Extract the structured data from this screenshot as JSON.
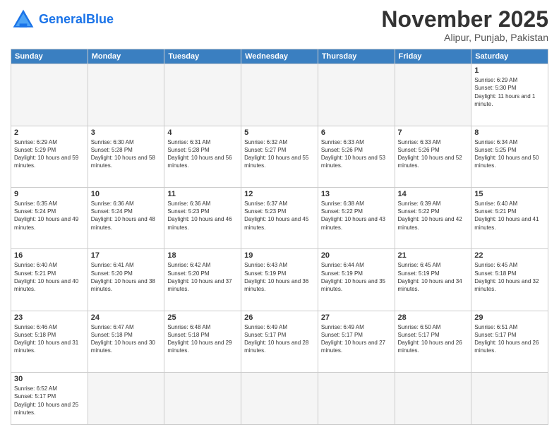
{
  "header": {
    "logo_general": "General",
    "logo_blue": "Blue",
    "title": "November 2025",
    "subtitle": "Alipur, Punjab, Pakistan"
  },
  "weekdays": [
    "Sunday",
    "Monday",
    "Tuesday",
    "Wednesday",
    "Thursday",
    "Friday",
    "Saturday"
  ],
  "weeks": [
    [
      {
        "day": "",
        "empty": true
      },
      {
        "day": "",
        "empty": true
      },
      {
        "day": "",
        "empty": true
      },
      {
        "day": "",
        "empty": true
      },
      {
        "day": "",
        "empty": true
      },
      {
        "day": "",
        "empty": true
      },
      {
        "day": "1",
        "sunrise": "Sunrise: 6:29 AM",
        "sunset": "Sunset: 5:30 PM",
        "daylight": "Daylight: 11 hours and 1 minute."
      }
    ],
    [
      {
        "day": "2",
        "sunrise": "Sunrise: 6:29 AM",
        "sunset": "Sunset: 5:29 PM",
        "daylight": "Daylight: 10 hours and 59 minutes."
      },
      {
        "day": "3",
        "sunrise": "Sunrise: 6:30 AM",
        "sunset": "Sunset: 5:28 PM",
        "daylight": "Daylight: 10 hours and 58 minutes."
      },
      {
        "day": "4",
        "sunrise": "Sunrise: 6:31 AM",
        "sunset": "Sunset: 5:28 PM",
        "daylight": "Daylight: 10 hours and 56 minutes."
      },
      {
        "day": "5",
        "sunrise": "Sunrise: 6:32 AM",
        "sunset": "Sunset: 5:27 PM",
        "daylight": "Daylight: 10 hours and 55 minutes."
      },
      {
        "day": "6",
        "sunrise": "Sunrise: 6:33 AM",
        "sunset": "Sunset: 5:26 PM",
        "daylight": "Daylight: 10 hours and 53 minutes."
      },
      {
        "day": "7",
        "sunrise": "Sunrise: 6:33 AM",
        "sunset": "Sunset: 5:26 PM",
        "daylight": "Daylight: 10 hours and 52 minutes."
      },
      {
        "day": "8",
        "sunrise": "Sunrise: 6:34 AM",
        "sunset": "Sunset: 5:25 PM",
        "daylight": "Daylight: 10 hours and 50 minutes."
      }
    ],
    [
      {
        "day": "9",
        "sunrise": "Sunrise: 6:35 AM",
        "sunset": "Sunset: 5:24 PM",
        "daylight": "Daylight: 10 hours and 49 minutes."
      },
      {
        "day": "10",
        "sunrise": "Sunrise: 6:36 AM",
        "sunset": "Sunset: 5:24 PM",
        "daylight": "Daylight: 10 hours and 48 minutes."
      },
      {
        "day": "11",
        "sunrise": "Sunrise: 6:36 AM",
        "sunset": "Sunset: 5:23 PM",
        "daylight": "Daylight: 10 hours and 46 minutes."
      },
      {
        "day": "12",
        "sunrise": "Sunrise: 6:37 AM",
        "sunset": "Sunset: 5:23 PM",
        "daylight": "Daylight: 10 hours and 45 minutes."
      },
      {
        "day": "13",
        "sunrise": "Sunrise: 6:38 AM",
        "sunset": "Sunset: 5:22 PM",
        "daylight": "Daylight: 10 hours and 43 minutes."
      },
      {
        "day": "14",
        "sunrise": "Sunrise: 6:39 AM",
        "sunset": "Sunset: 5:22 PM",
        "daylight": "Daylight: 10 hours and 42 minutes."
      },
      {
        "day": "15",
        "sunrise": "Sunrise: 6:40 AM",
        "sunset": "Sunset: 5:21 PM",
        "daylight": "Daylight: 10 hours and 41 minutes."
      }
    ],
    [
      {
        "day": "16",
        "sunrise": "Sunrise: 6:40 AM",
        "sunset": "Sunset: 5:21 PM",
        "daylight": "Daylight: 10 hours and 40 minutes."
      },
      {
        "day": "17",
        "sunrise": "Sunrise: 6:41 AM",
        "sunset": "Sunset: 5:20 PM",
        "daylight": "Daylight: 10 hours and 38 minutes."
      },
      {
        "day": "18",
        "sunrise": "Sunrise: 6:42 AM",
        "sunset": "Sunset: 5:20 PM",
        "daylight": "Daylight: 10 hours and 37 minutes."
      },
      {
        "day": "19",
        "sunrise": "Sunrise: 6:43 AM",
        "sunset": "Sunset: 5:19 PM",
        "daylight": "Daylight: 10 hours and 36 minutes."
      },
      {
        "day": "20",
        "sunrise": "Sunrise: 6:44 AM",
        "sunset": "Sunset: 5:19 PM",
        "daylight": "Daylight: 10 hours and 35 minutes."
      },
      {
        "day": "21",
        "sunrise": "Sunrise: 6:45 AM",
        "sunset": "Sunset: 5:19 PM",
        "daylight": "Daylight: 10 hours and 34 minutes."
      },
      {
        "day": "22",
        "sunrise": "Sunrise: 6:45 AM",
        "sunset": "Sunset: 5:18 PM",
        "daylight": "Daylight: 10 hours and 32 minutes."
      }
    ],
    [
      {
        "day": "23",
        "sunrise": "Sunrise: 6:46 AM",
        "sunset": "Sunset: 5:18 PM",
        "daylight": "Daylight: 10 hours and 31 minutes."
      },
      {
        "day": "24",
        "sunrise": "Sunrise: 6:47 AM",
        "sunset": "Sunset: 5:18 PM",
        "daylight": "Daylight: 10 hours and 30 minutes."
      },
      {
        "day": "25",
        "sunrise": "Sunrise: 6:48 AM",
        "sunset": "Sunset: 5:18 PM",
        "daylight": "Daylight: 10 hours and 29 minutes."
      },
      {
        "day": "26",
        "sunrise": "Sunrise: 6:49 AM",
        "sunset": "Sunset: 5:17 PM",
        "daylight": "Daylight: 10 hours and 28 minutes."
      },
      {
        "day": "27",
        "sunrise": "Sunrise: 6:49 AM",
        "sunset": "Sunset: 5:17 PM",
        "daylight": "Daylight: 10 hours and 27 minutes."
      },
      {
        "day": "28",
        "sunrise": "Sunrise: 6:50 AM",
        "sunset": "Sunset: 5:17 PM",
        "daylight": "Daylight: 10 hours and 26 minutes."
      },
      {
        "day": "29",
        "sunrise": "Sunrise: 6:51 AM",
        "sunset": "Sunset: 5:17 PM",
        "daylight": "Daylight: 10 hours and 26 minutes."
      }
    ],
    [
      {
        "day": "30",
        "sunrise": "Sunrise: 6:52 AM",
        "sunset": "Sunset: 5:17 PM",
        "daylight": "Daylight: 10 hours and 25 minutes."
      },
      {
        "day": "",
        "empty": true
      },
      {
        "day": "",
        "empty": true
      },
      {
        "day": "",
        "empty": true
      },
      {
        "day": "",
        "empty": true
      },
      {
        "day": "",
        "empty": true
      },
      {
        "day": "",
        "empty": true
      }
    ]
  ]
}
